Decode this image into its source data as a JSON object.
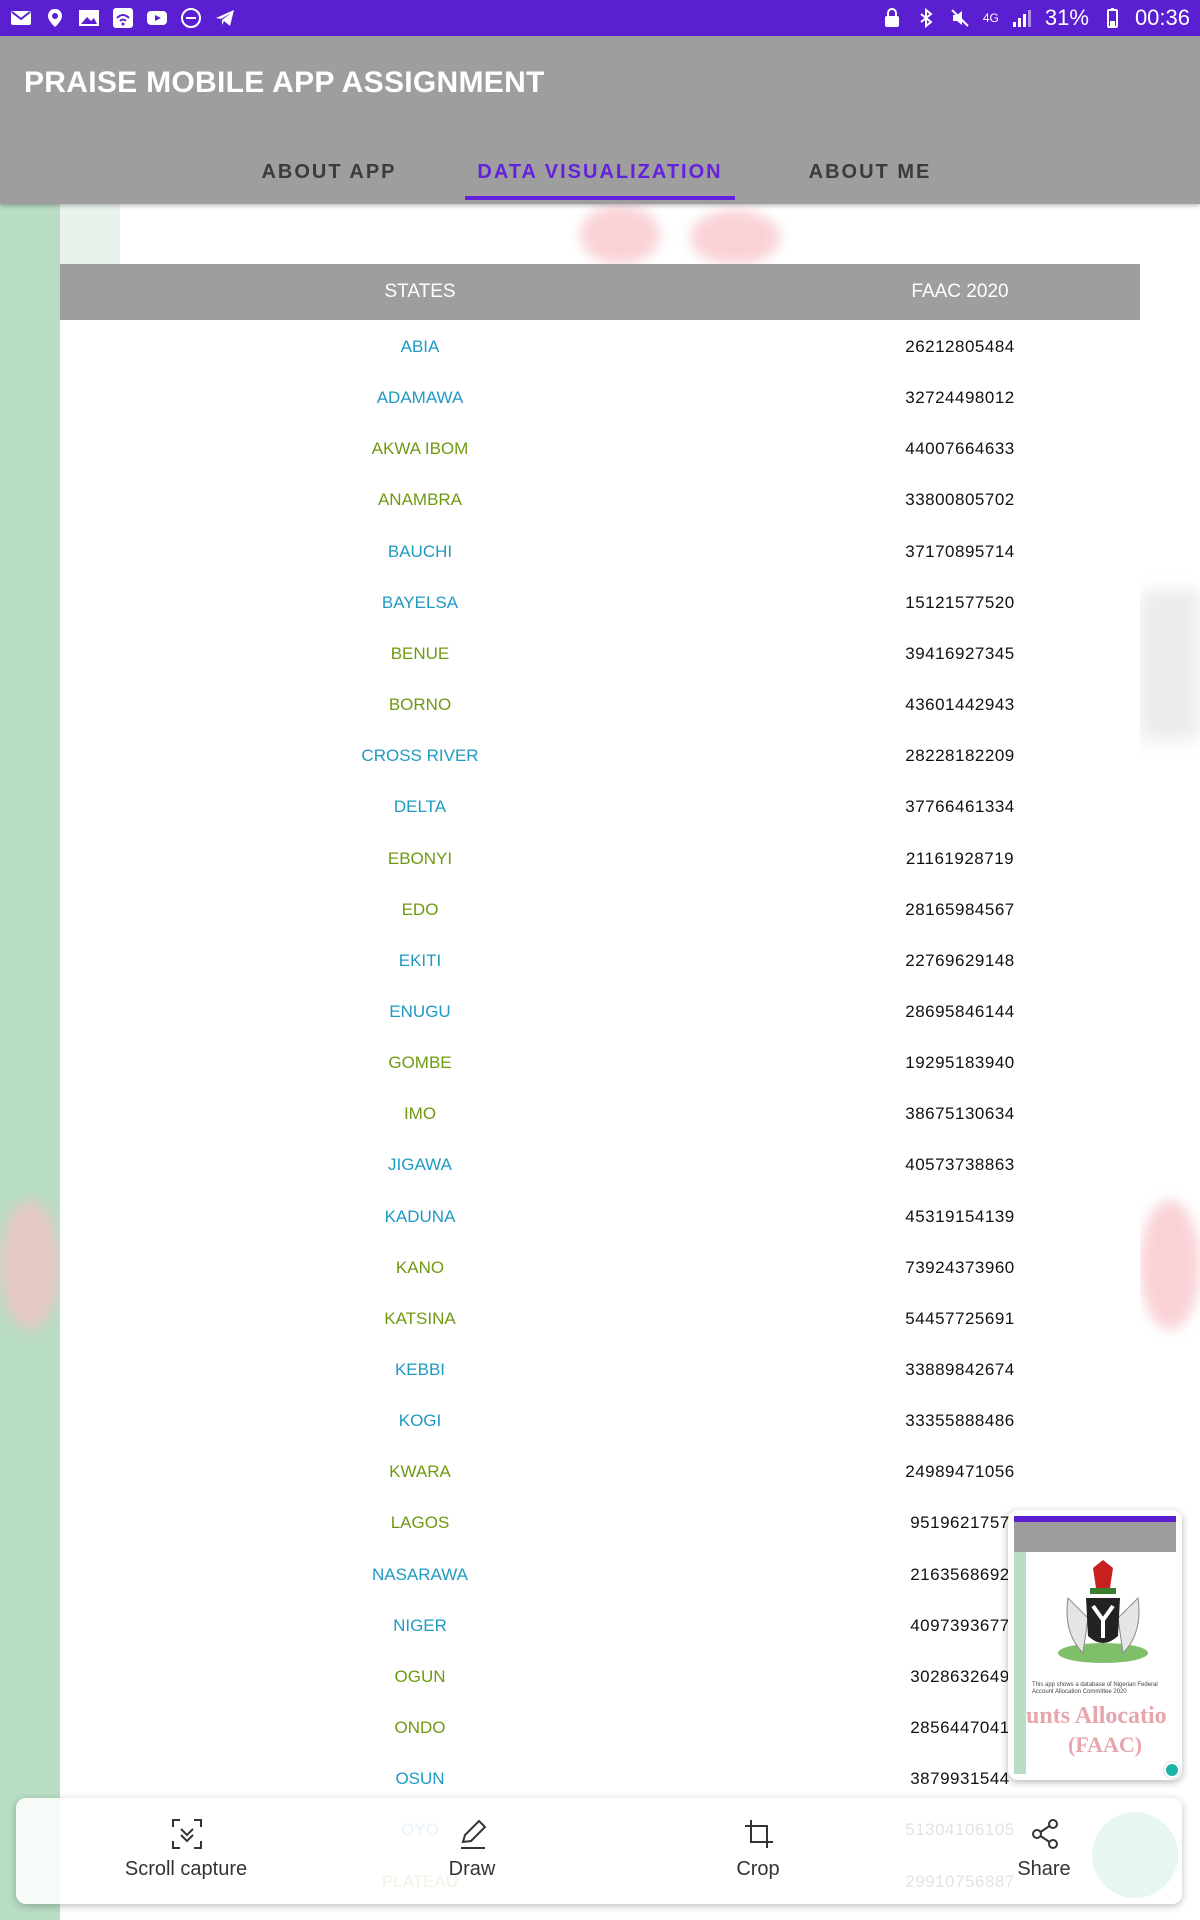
{
  "status_bar": {
    "battery": "31%",
    "time": "00:36",
    "network": "4G",
    "left_icons": [
      "mail-icon",
      "location-icon",
      "image-icon",
      "wifi-hotspot-icon",
      "youtube-icon",
      "do-not-disturb-icon",
      "telegram-icon"
    ],
    "right_icons": [
      "lock-icon",
      "bluetooth-icon",
      "mute-icon",
      "signal-icon",
      "battery-icon"
    ]
  },
  "app": {
    "title": "PRAISE MOBILE APP ASSIGNMENT",
    "tabs": [
      {
        "label": "ABOUT APP",
        "active": false
      },
      {
        "label": "DATA VISUALIZATION",
        "active": true
      },
      {
        "label": "ABOUT ME",
        "active": false
      }
    ],
    "accent_color": "#6420dd",
    "appbar_color": "#9e9e9e"
  },
  "table": {
    "headers": [
      "STATES",
      "FAAC 2020"
    ],
    "state_colors": {
      "blue": "#1f9ac2",
      "green": "#6f9a10"
    },
    "rows": [
      {
        "state": "ABIA",
        "value": "26212805484",
        "color": "blue"
      },
      {
        "state": "ADAMAWA",
        "value": "32724498012",
        "color": "blue"
      },
      {
        "state": "AKWA IBOM",
        "value": "44007664633",
        "color": "green"
      },
      {
        "state": "ANAMBRA",
        "value": "33800805702",
        "color": "green"
      },
      {
        "state": "BAUCHI",
        "value": "37170895714",
        "color": "blue"
      },
      {
        "state": "BAYELSA",
        "value": "15121577520",
        "color": "blue"
      },
      {
        "state": "BENUE",
        "value": "39416927345",
        "color": "green"
      },
      {
        "state": "BORNO",
        "value": "43601442943",
        "color": "green"
      },
      {
        "state": "CROSS RIVER",
        "value": "28228182209",
        "color": "blue"
      },
      {
        "state": "DELTA",
        "value": "37766461334",
        "color": "blue"
      },
      {
        "state": "EBONYI",
        "value": "21161928719",
        "color": "green"
      },
      {
        "state": "EDO",
        "value": "28165984567",
        "color": "green"
      },
      {
        "state": "EKITI",
        "value": "22769629148",
        "color": "blue"
      },
      {
        "state": "ENUGU",
        "value": "28695846144",
        "color": "blue"
      },
      {
        "state": "GOMBE",
        "value": "19295183940",
        "color": "green"
      },
      {
        "state": "IMO",
        "value": "38675130634",
        "color": "green"
      },
      {
        "state": "JIGAWA",
        "value": "40573738863",
        "color": "blue"
      },
      {
        "state": "KADUNA",
        "value": "45319154139",
        "color": "blue"
      },
      {
        "state": "KANO",
        "value": "73924373960",
        "color": "green"
      },
      {
        "state": "KATSINA",
        "value": "54457725691",
        "color": "green"
      },
      {
        "state": "KEBBI",
        "value": "33889842674",
        "color": "blue"
      },
      {
        "state": "KOGI",
        "value": "33355888486",
        "color": "blue"
      },
      {
        "state": "KWARA",
        "value": "24989471056",
        "color": "green"
      },
      {
        "state": "LAGOS",
        "value": "9519621757",
        "color": "green"
      },
      {
        "state": "NASARAWA",
        "value": "2163568692",
        "color": "blue"
      },
      {
        "state": "NIGER",
        "value": "4097393677",
        "color": "blue"
      },
      {
        "state": "OGUN",
        "value": "3028632649",
        "color": "green"
      },
      {
        "state": "ONDO",
        "value": "2856447041",
        "color": "green"
      },
      {
        "state": "OSUN",
        "value": "3879931544",
        "color": "blue"
      },
      {
        "state": "OYO",
        "value": "51304106105",
        "color": "blue"
      },
      {
        "state": "PLATEAU",
        "value": "29910756887",
        "color": "green"
      }
    ]
  },
  "thumbnail": {
    "caption": "This app shows a database of Nigerian Federal Account Allocation Committee 2020",
    "text_line1": "unts Allocatio",
    "text_line2": "(FAAC)"
  },
  "capture_toolbar": {
    "items": [
      {
        "label": "Scroll capture",
        "icon": "scroll-capture-icon"
      },
      {
        "label": "Draw",
        "icon": "pencil-icon"
      },
      {
        "label": "Crop",
        "icon": "crop-icon"
      },
      {
        "label": "Share",
        "icon": "share-icon"
      }
    ]
  }
}
